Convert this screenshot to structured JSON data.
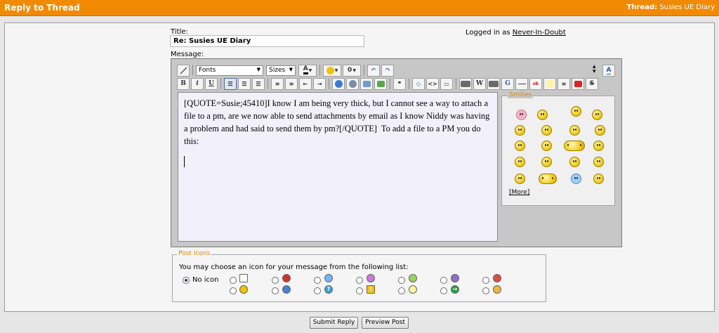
{
  "header": {
    "title": "Reply to Thread",
    "thread_label": "Thread:",
    "thread_name": "Susies UE Diary"
  },
  "form": {
    "title_label": "Title:",
    "title_value": "Re: Susies UE Diary",
    "logged_in_prefix": "Logged in as",
    "logged_in_user": "Never-In-Doubt",
    "message_label": "Message:"
  },
  "toolbar": {
    "font_select": "Fonts",
    "size_select": "Sizes",
    "bold": "B",
    "italic": "i",
    "underline": "U"
  },
  "message_text": "[QUOTE=Susie;45410]I know I am being very thick, but I cannot see a way to attach a file to a pm, are we now able to send attachments by email as I know Niddy was having a problem and had said to send them by pm?[/QUOTE]  To add a file to a PM you do this:",
  "smilies": {
    "legend": "Smilies",
    "more": "[More]"
  },
  "post_icons": {
    "legend": "Post Icons",
    "description": "You may choose an icon for your message from the following list:",
    "no_icon_label": "No icon",
    "selected": "No icon",
    "icon_names": [
      "page-icon",
      "thumbs-down-icon",
      "smile-icon",
      "grin-icon",
      "big-grin-icon",
      "sad-icon",
      "angry-icon",
      "smiley-icon",
      "cool-icon",
      "question-icon",
      "warning-icon",
      "lightbulb-icon",
      "arrow-icon",
      "thumbs-up-icon"
    ]
  },
  "buttons": {
    "submit": "Submit Reply",
    "preview": "Preview Post"
  },
  "colors": {
    "header": "#f28a00",
    "editor_bg": "#c7c7c7",
    "text_area": "#f2f1fb",
    "legend": "#e08800"
  }
}
